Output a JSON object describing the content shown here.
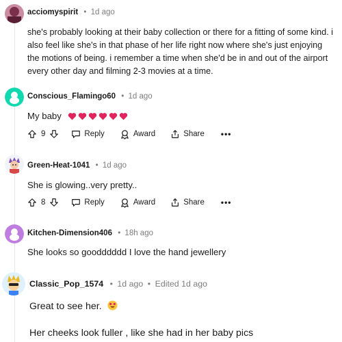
{
  "comments": [
    {
      "username": "acciomyspirit",
      "time": "1d ago",
      "body": "she's probably looking at their baby collection or there for a fitting of some kind. i also feel like she's in that phase of her life right now where she's just enjoying the motions of being. i remember a time when she'd be in and out of the airport every other day and filming 2-3 movies at a time.",
      "avatar_color": "#7a2f4a"
    },
    {
      "username": "Conscious_Flamingo60",
      "time": "1d ago",
      "body": "My baby",
      "emoji": "heart-emoji x6",
      "votes": "9",
      "reply_label": "Reply",
      "award_label": "Award",
      "share_label": "Share",
      "more_label": "•••",
      "avatar_color": "#12d8b0"
    },
    {
      "username": "Green-Heat-1041",
      "time": "1d ago",
      "body": "She is glowing..very pretty..",
      "votes": "8",
      "reply_label": "Reply",
      "award_label": "Award",
      "share_label": "Share",
      "more_label": "•••",
      "avatar_color": "#f1f3f7"
    },
    {
      "username": "Kitchen-Dimension406",
      "time": "18h ago",
      "body": "She looks so goodddddd I love the hand jewellery",
      "avatar_color": "#c07de0"
    },
    {
      "username": "Classic_Pop_1574",
      "time": "1d ago",
      "edited": "Edited 1d ago",
      "body_line1": "Great to see her.",
      "body_line2": "Her cheeks look fuller , like she had in her baby pics",
      "emoji": "heart-eyes-emoji",
      "avatar_color": "#e8b923"
    }
  ],
  "separator": "•",
  "colors": {
    "meta": "#7c7c7c",
    "heart": "#e0245e",
    "thread": "#e5e7eb"
  }
}
